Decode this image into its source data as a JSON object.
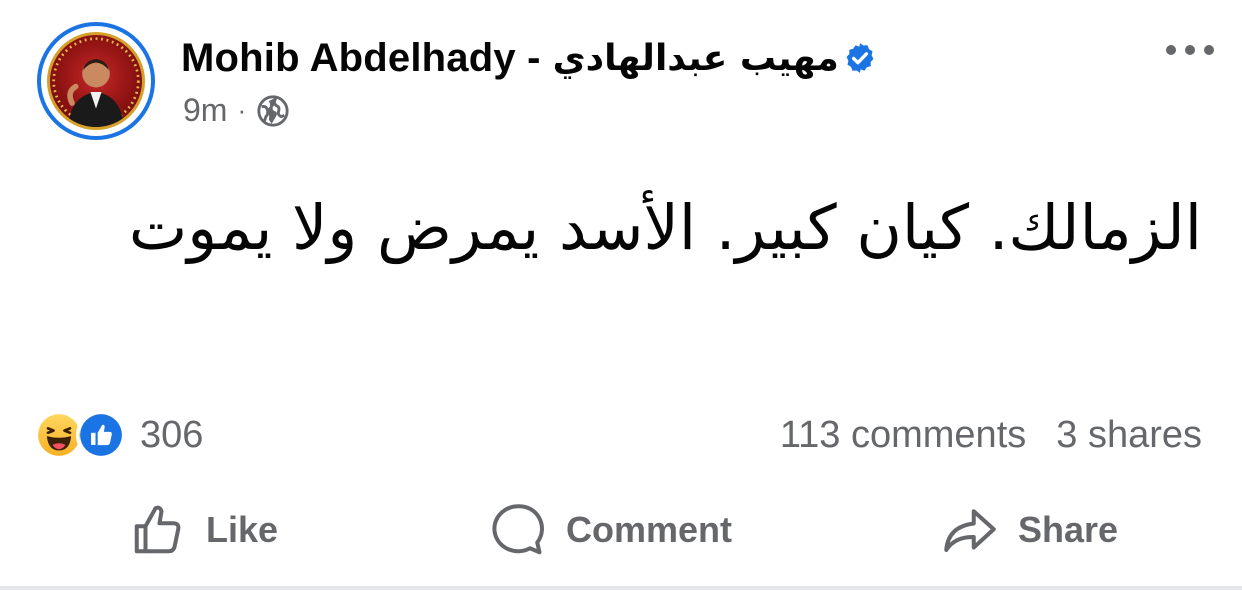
{
  "post": {
    "author": {
      "name_latin": "Mohib Abdelhady -",
      "name_arabic": "مهيب عبدالهادي",
      "verified": true,
      "avatar_icon": "profile-photo"
    },
    "meta": {
      "time": "9m",
      "separator": "·",
      "audience_icon": "globe-icon"
    },
    "more_icon": "ellipsis-icon",
    "text": "الزمالك. كيان كبير. الأسد  يمرض ولا يموت",
    "stats": {
      "reaction_icons": [
        "haha-icon",
        "like-icon"
      ],
      "reaction_count": "306",
      "comments": "113 comments",
      "shares": "3 shares"
    },
    "actions": {
      "like": "Like",
      "comment": "Comment",
      "share": "Share"
    },
    "colors": {
      "accent": "#1b74e4",
      "text_secondary": "#65676b",
      "text_primary": "#050505",
      "verified": "#1b74e4"
    }
  }
}
